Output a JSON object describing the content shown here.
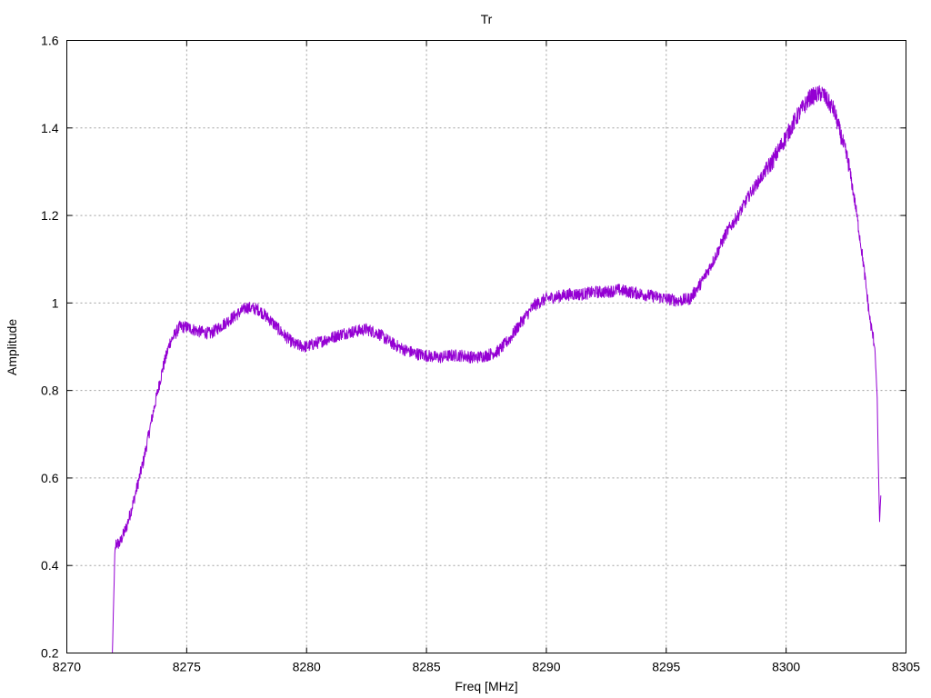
{
  "chart_data": {
    "type": "line",
    "title": "Tr",
    "xlabel": "Freq [MHz]",
    "ylabel": "Amplitude",
    "xlim": [
      8270,
      8305
    ],
    "ylim": [
      0.2,
      1.6
    ],
    "grid": true,
    "legend": "none",
    "x_ticks": [
      "8270",
      "8275",
      "8280",
      "8285",
      "8290",
      "8295",
      "8300",
      "8305"
    ],
    "y_ticks": [
      "0.2",
      "0.4",
      "0.6",
      "0.8",
      "1",
      "1.2",
      "1.4",
      "1.6"
    ],
    "series": [
      {
        "color": "#9400d3",
        "x": [
          8271.9,
          8272.0,
          8272.05,
          8272.2,
          8272.5,
          8272.8,
          8273.2,
          8273.6,
          8274.0,
          8274.3,
          8274.7,
          8275.0,
          8275.5,
          8276.0,
          8276.5,
          8277.0,
          8277.5,
          8278.0,
          8278.5,
          8279.0,
          8279.5,
          8280.0,
          8280.5,
          8281.0,
          8281.5,
          8282.0,
          8282.5,
          8283.0,
          8283.5,
          8284.0,
          8284.5,
          8285.0,
          8285.5,
          8286.0,
          8286.5,
          8287.0,
          8287.5,
          8288.0,
          8288.5,
          8289.0,
          8289.5,
          8290.0,
          8290.5,
          8291.0,
          8291.5,
          8292.0,
          8292.5,
          8293.0,
          8293.5,
          8294.0,
          8294.5,
          8295.0,
          8295.5,
          8296.0,
          8296.5,
          8297.0,
          8297.5,
          8298.0,
          8298.5,
          8299.0,
          8299.5,
          8300.0,
          8300.5,
          8301.0,
          8301.5,
          8302.0,
          8302.3,
          8302.6,
          8302.9,
          8303.2,
          8303.5,
          8303.7,
          8303.8,
          8303.85,
          8303.9,
          8303.95
        ],
        "values": [
          0.2,
          0.42,
          0.45,
          0.45,
          0.49,
          0.55,
          0.64,
          0.75,
          0.85,
          0.91,
          0.945,
          0.945,
          0.935,
          0.93,
          0.95,
          0.97,
          0.99,
          0.985,
          0.96,
          0.93,
          0.905,
          0.9,
          0.91,
          0.92,
          0.93,
          0.935,
          0.94,
          0.93,
          0.91,
          0.895,
          0.885,
          0.88,
          0.875,
          0.88,
          0.88,
          0.875,
          0.88,
          0.89,
          0.92,
          0.96,
          0.995,
          1.01,
          1.015,
          1.02,
          1.02,
          1.025,
          1.025,
          1.03,
          1.025,
          1.02,
          1.015,
          1.01,
          1.005,
          1.01,
          1.05,
          1.1,
          1.16,
          1.2,
          1.25,
          1.29,
          1.33,
          1.38,
          1.43,
          1.47,
          1.48,
          1.44,
          1.38,
          1.32,
          1.22,
          1.1,
          0.96,
          0.9,
          0.78,
          0.62,
          0.5,
          0.56
        ]
      }
    ]
  }
}
